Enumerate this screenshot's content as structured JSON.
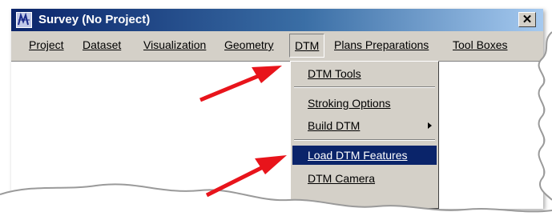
{
  "window": {
    "title": "Survey (No Project)",
    "close_glyph": "✕"
  },
  "menubar": {
    "items": [
      {
        "label": "Project"
      },
      {
        "label": "Dataset"
      },
      {
        "label": "Visualization"
      },
      {
        "label": "Geometry"
      },
      {
        "label": "DTM",
        "active": true
      },
      {
        "label": "Plans Preparations"
      },
      {
        "label": "Tool Boxes"
      }
    ]
  },
  "dropdown": {
    "items": [
      {
        "label": "DTM Tools"
      },
      {
        "label": "Stroking Options"
      },
      {
        "label": "Build DTM",
        "submenu": true
      },
      {
        "label": "Load DTM Features",
        "highlighted": true
      },
      {
        "label": "DTM Camera"
      }
    ]
  },
  "colors": {
    "title_gradient_start": "#0a246a",
    "title_gradient_end": "#a6caf0",
    "menu_face": "#d4d0c8",
    "highlight": "#0a246a",
    "arrow_red": "#e8141b"
  },
  "icons": {
    "app": "survey-app-icon",
    "arrows": "red-callout-arrow"
  }
}
